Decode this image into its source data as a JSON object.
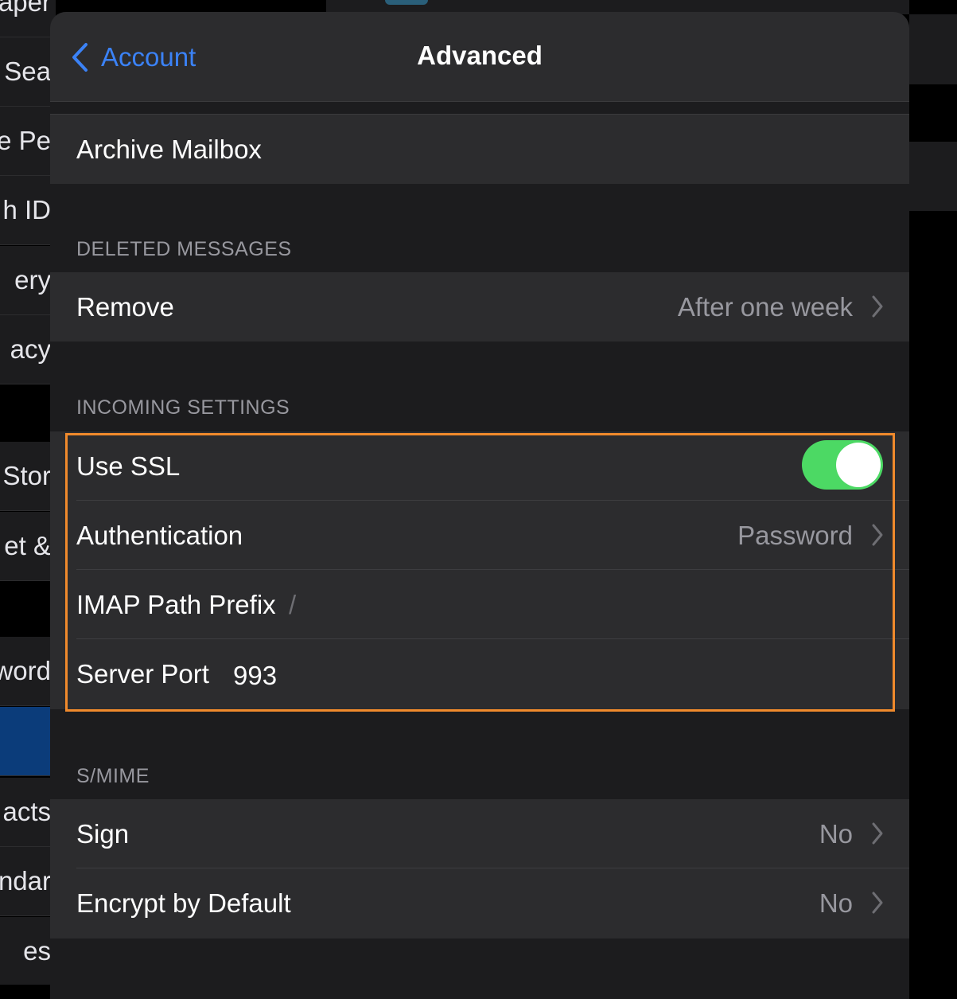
{
  "background_list": [
    {
      "label": "paper"
    },
    {
      "label": "& Sea"
    },
    {
      "label": "e Pe"
    },
    {
      "label": "h ID"
    },
    {
      "label": "ery"
    },
    {
      "label": "acy"
    },
    {
      "label": "Stor"
    },
    {
      "label": "et &"
    },
    {
      "label": "word"
    },
    {
      "label": ""
    },
    {
      "label": "acts"
    },
    {
      "label": "ndar"
    },
    {
      "label": "es"
    }
  ],
  "navbar": {
    "back_label": "Account",
    "title": "Advanced"
  },
  "archive": {
    "label": "Archive Mailbox"
  },
  "deleted_messages": {
    "header": "DELETED MESSAGES",
    "remove_label": "Remove",
    "remove_value": "After one week"
  },
  "incoming_settings": {
    "header": "INCOMING SETTINGS",
    "use_ssl_label": "Use SSL",
    "use_ssl_on": true,
    "authentication_label": "Authentication",
    "authentication_value": "Password",
    "imap_prefix_label": "IMAP Path Prefix",
    "imap_prefix_value": "/",
    "server_port_label": "Server Port",
    "server_port_value": "993"
  },
  "smime": {
    "header": "S/MIME",
    "sign_label": "Sign",
    "sign_value": "No",
    "encrypt_label": "Encrypt by Default",
    "encrypt_value": "No"
  },
  "colors": {
    "accent": "#3b82f6",
    "toggle_on": "#4cd964",
    "highlight": "#f08a2c"
  }
}
